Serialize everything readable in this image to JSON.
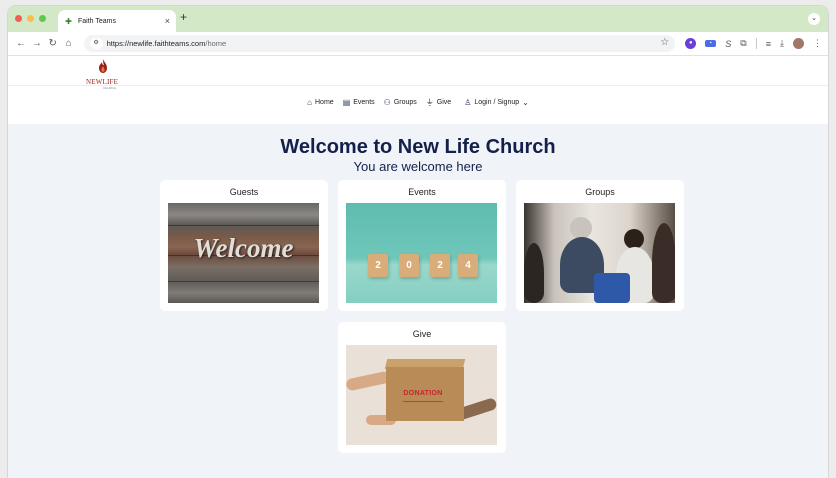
{
  "browser": {
    "tab_title": "Faith Teams",
    "tab_close": "×",
    "new_tab": "+",
    "url_host": "https://newlife.faithteams.com",
    "url_path": "/home"
  },
  "site": {
    "logo_text": "NEWLIFE",
    "logo_sub": "CHURCH",
    "brand_color": "#9c1f1f"
  },
  "nav": {
    "items": [
      {
        "label": "Home",
        "icon": "home-icon"
      },
      {
        "label": "Events",
        "icon": "calendar-icon"
      },
      {
        "label": "Groups",
        "icon": "people-icon"
      },
      {
        "label": "Give",
        "icon": "give-icon"
      },
      {
        "label": "Login / Signup",
        "icon": "user-icon"
      }
    ]
  },
  "hero": {
    "title": "Welcome to New Life Church",
    "subtitle": "You are welcome here",
    "title_color": "#14204a"
  },
  "cards": [
    {
      "title": "Guests",
      "image_text": "Welcome"
    },
    {
      "title": "Events",
      "image_digits": [
        "2",
        "0",
        "2",
        "4"
      ]
    },
    {
      "title": "Groups"
    },
    {
      "title": "Give",
      "image_text": "DONATION"
    }
  ]
}
